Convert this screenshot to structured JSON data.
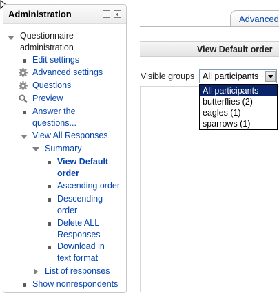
{
  "block": {
    "title": "Administration",
    "dock_icon": "dock-icon",
    "move_icon": "move-icon"
  },
  "nav": {
    "questionnaire_admin": "Questionnaire administration",
    "edit_settings": "Edit settings",
    "advanced_settings": "Advanced settings",
    "questions": "Questions",
    "preview": "Preview",
    "answer_questions": "Answer the questions...",
    "view_all_responses": "View All Responses",
    "summary": "Summary",
    "view_default_order": "View Default order",
    "ascending_order": "Ascending order",
    "descending_order": "Descending order",
    "delete_all_responses": "Delete ALL Responses",
    "download_text_format": "Download in text format",
    "list_of_responses": "List of responses",
    "show_nonrespondents": "Show nonrespondents"
  },
  "content": {
    "tab_label": "Advanced",
    "page_title": "View Default order",
    "visible_groups_label": "Visible groups",
    "selected_group": "All participants",
    "group_options": [
      "All participants",
      "butterflies (2)",
      "eagles (1)",
      "sparrows (1)"
    ]
  },
  "colors": {
    "link": "#0645ad",
    "selected_option_bg": "#0a246a",
    "header_bg": "#ececec"
  }
}
